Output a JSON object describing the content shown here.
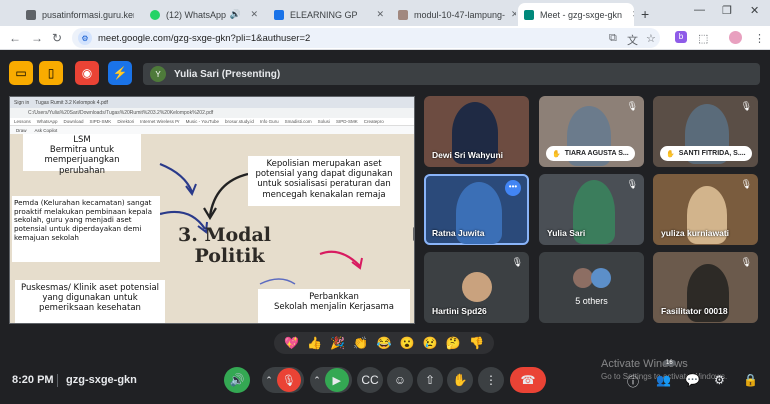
{
  "browser": {
    "tabs": [
      {
        "label": "pusatinformasi.guru.kem",
        "favicon_color": "#5f6368"
      },
      {
        "label": "(12) WhatsApp",
        "favicon_color": "#25d366"
      },
      {
        "label": "ELEARNING GP",
        "favicon_color": "#1a73e8"
      },
      {
        "label": "modul-10-47-lampung-",
        "favicon_color": "#a1887f"
      },
      {
        "label": "Meet - gzg-sxge-gkn",
        "favicon_color": "#00897b"
      }
    ],
    "url": "meet.google.com/gzg-sxge-gkn?pli=1&authuser=2",
    "ext_label": "b"
  },
  "meet": {
    "presenter_initial": "Y",
    "presenter_label": "Yulia Sari (Presenting)",
    "shared_screen": {
      "window_tabs": [
        "Sign in",
        "Tugas Rumit 3.2 Kelompok 4.pdf"
      ],
      "file_path": "C:/Users/Yulia%20Sari/Downloads/Tugas%20Rumit%203.2%20Kelompok%202.pdf",
      "bookmarks": [
        "Lessons",
        "WhatsApp",
        "Download",
        "SIPD-SMK",
        "Direktori",
        "Internet Wireless Pr",
        "Music - YouTube",
        "brosur.study.id",
        "Info Guru",
        "Smadisti.com",
        "Solusi",
        "SIPD-SMK",
        "Createpro"
      ],
      "pdf_tools": [
        "Draw",
        "Ask Copilot"
      ],
      "slide": {
        "notes": [
          "LSM\nBermitra untuk memperjuangkan perubahan",
          "Kepolisian merupakan aset potensial yang dapat digunakan untuk sosialisasi peraturan dan mencegah kenakalan remaja",
          "Pemda (Kelurahan kecamatan) sangat proaktif melakukan pembinaan kepala sekolah, guru yang menjadi aset potensial untuk diperdayakan demi kemajuan sekolah",
          "Puskesmas/ Klinik aset potensial yang digunakan untuk pemeriksaan kesehatan",
          "Perbankkan\nSekolah menjalin Kerjasama"
        ],
        "title_line1": "3. Modal",
        "title_line2": "Politik"
      }
    },
    "participants": [
      {
        "name": "Dewi Sri Wahyuni",
        "muted": false,
        "bg": "#6d4c41",
        "face": "#1f2a44"
      },
      {
        "name": "TIARA AGUSTA S...",
        "muted": true,
        "hand_raised": true,
        "bg": "#8d8077",
        "face": "#6b7b8c"
      },
      {
        "name": "SANTI FITRIDA, S....",
        "muted": true,
        "hand_raised": true,
        "bg": "#5a4e46",
        "face": "#5a6b7a"
      },
      {
        "name": "Ratna Juwita",
        "muted": false,
        "speaking": true,
        "bg": "#2b4a7a",
        "face": "#3b6fb6"
      },
      {
        "name": "Yulia Sari",
        "muted": true,
        "bg": "#4a4f55",
        "face": "#3b7d5c"
      },
      {
        "name": "yuliza kurniawati",
        "muted": true,
        "bg": "#7a5c3e",
        "face": "#d2b48c"
      },
      {
        "name": "Hartini Spd26",
        "muted": true,
        "bg": "#3c4043",
        "face": "#c9a27e"
      },
      {
        "name": "5 others",
        "muted": false,
        "bg": "#3c4043",
        "face": "#8d6e63"
      },
      {
        "name": "Fasilitator 00018",
        "muted": true,
        "bg": "#6b5a4c",
        "face": "#2d2a26"
      }
    ],
    "reactions": [
      "💖",
      "👍",
      "🎉",
      "👏",
      "😂",
      "😮",
      "😢",
      "🤔",
      "👎"
    ],
    "bottom_bar": {
      "time": "8:20 PM",
      "meeting_code": "gzg-sxge-gkn",
      "participant_count": "16",
      "activate_windows": "Activate Windows",
      "activate_windows_sub": "Go to Settings to activate Windows."
    }
  }
}
